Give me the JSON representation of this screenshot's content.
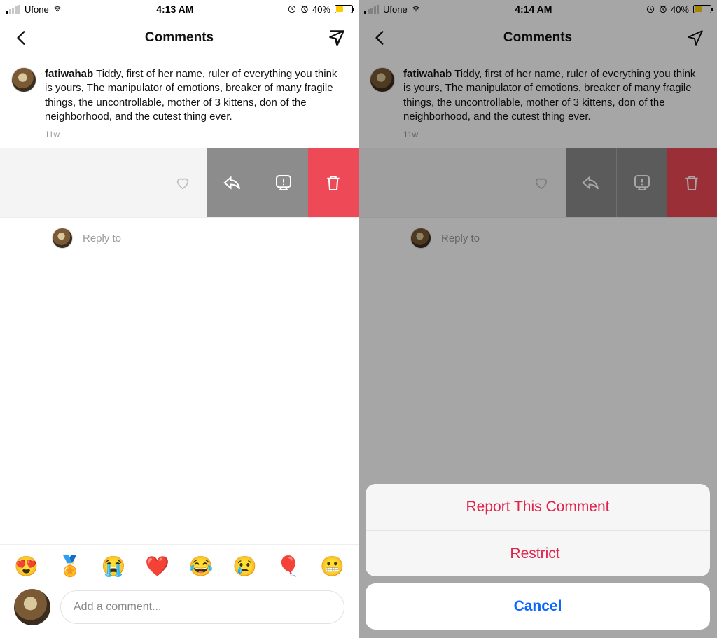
{
  "left": {
    "status": {
      "carrier": "Ufone",
      "time": "4:13 AM",
      "battery_pct": "40%"
    },
    "nav_title": "Comments",
    "post": {
      "username": "fatiwahab",
      "caption": "Tiddy, first of her name, ruler of everything you think is yours, The manipulator of emotions, breaker of many fragile things, the uncontrollable, mother of 3 kittens, don of the neighborhood, and the cutest thing ever.",
      "age": "11w"
    },
    "reply_label": "Reply to",
    "composer_placeholder": "Add a comment...",
    "emoji": [
      "😍",
      "🏅",
      "😭",
      "❤️",
      "😂",
      "😢",
      "🎈",
      "😬"
    ]
  },
  "right": {
    "status": {
      "carrier": "Ufone",
      "time": "4:14 AM",
      "battery_pct": "40%"
    },
    "nav_title": "Comments",
    "post": {
      "username": "fatiwahab",
      "caption": "Tiddy, first of her name, ruler of everything you think is yours, The manipulator of emotions, breaker of many fragile things, the uncontrollable, mother of 3 kittens, don of the neighborhood, and the cutest thing ever.",
      "age": "11w"
    },
    "reply_label": "Reply to",
    "sheet": {
      "report": "Report This Comment",
      "restrict": "Restrict",
      "restrict_redacted": " ",
      "cancel": "Cancel"
    }
  }
}
